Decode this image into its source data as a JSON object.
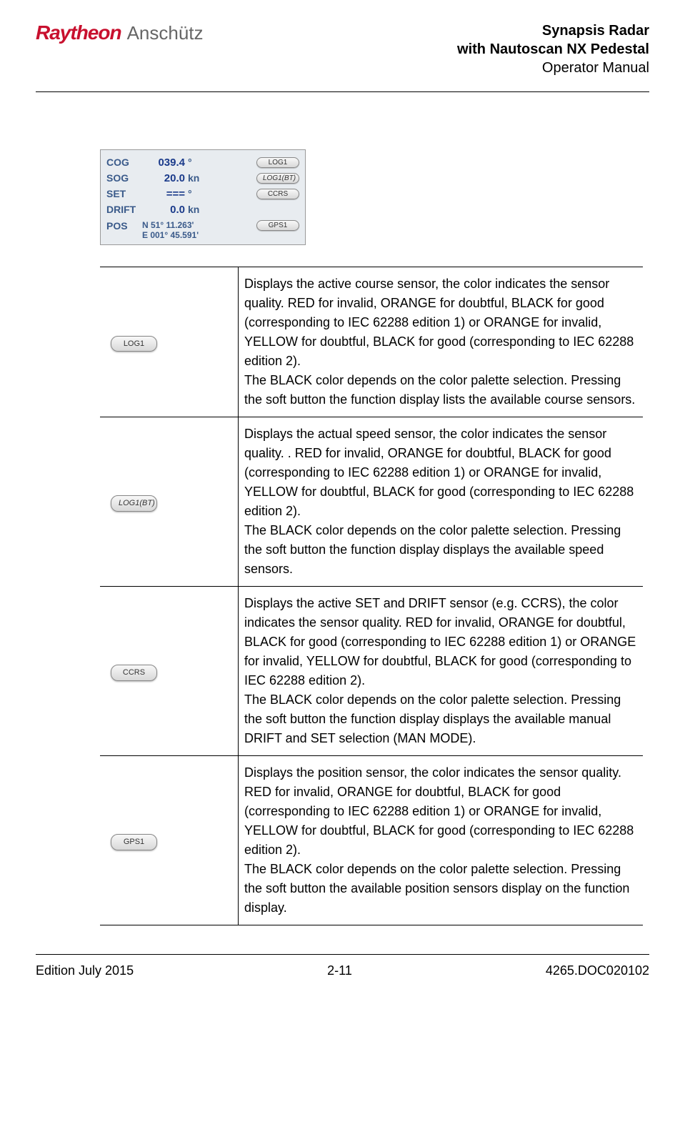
{
  "header": {
    "logo_raytheon": "Raytheon",
    "logo_anschutz": "Anschütz",
    "title_line1": "Synapsis Radar",
    "title_line2": "with Nautoscan NX Pedestal",
    "title_line3": "Operator Manual"
  },
  "panel": {
    "rows": [
      {
        "label": "COG",
        "value": "039.4",
        "unit": "°",
        "button": "LOG1"
      },
      {
        "label": "SOG",
        "value": "20.0",
        "unit": "kn",
        "button": "LOG1(BT)",
        "italic": true
      },
      {
        "label": "SET",
        "value": "===",
        "unit": "°",
        "button": "CCRS"
      },
      {
        "label": "DRIFT",
        "value": "0.0",
        "unit": "kn",
        "button": ""
      }
    ],
    "pos_label": "POS",
    "pos_line1": "N 51° 11.263'",
    "pos_line2": "E 001° 45.591'",
    "pos_button": "GPS1"
  },
  "table": [
    {
      "button": "LOG1",
      "desc": "Displays the active course sensor, the color indicates the sensor quality. RED for invalid, ORANGE for doubtful, BLACK for good (corresponding to IEC 62288 edition 1) or ORANGE for invalid, YELLOW for doubtful, BLACK for good (corresponding to IEC 62288 edition 2).\nThe BLACK color depends on the color palette selection. Pressing the soft button the function display lists the available course sensors."
    },
    {
      "button": "LOG1(BT)",
      "italic": true,
      "desc": "Displays the actual speed sensor, the color indicates the sensor quality. . RED for invalid, ORANGE for doubtful, BLACK for good (corresponding to IEC 62288 edition 1) or ORANGE for invalid, YELLOW for doubtful, BLACK for good (corresponding to IEC 62288 edition 2).\nThe BLACK color depends on the color palette selection. Pressing the soft button the function display displays the available speed sensors."
    },
    {
      "button": "CCRS",
      "desc": "Displays the active SET and DRIFT sensor (e.g. CCRS), the color indicates the sensor quality. RED for invalid, ORANGE for doubtful, BLACK for good (corresponding to IEC 62288 edition 1) or ORANGE for invalid, YELLOW for doubtful, BLACK for good (corresponding to IEC 62288 edition 2).\nThe BLACK color depends on the color palette selection. Pressing the soft button the function display displays the available manual DRIFT and SET selection (MAN MODE)."
    },
    {
      "button": "GPS1",
      "desc": "Displays the position sensor, the color indicates the sensor quality. RED for invalid, ORANGE for doubtful, BLACK for good (corresponding to IEC 62288 edition 1) or ORANGE for invalid, YELLOW for doubtful, BLACK for good (corresponding to IEC 62288 edition 2).\nThe BLACK color depends on the color palette selection. Pressing the soft button the available position sensors display on the function display."
    }
  ],
  "footer": {
    "left": "Edition July 2015",
    "center": "2-11",
    "right": "4265.DOC020102"
  }
}
